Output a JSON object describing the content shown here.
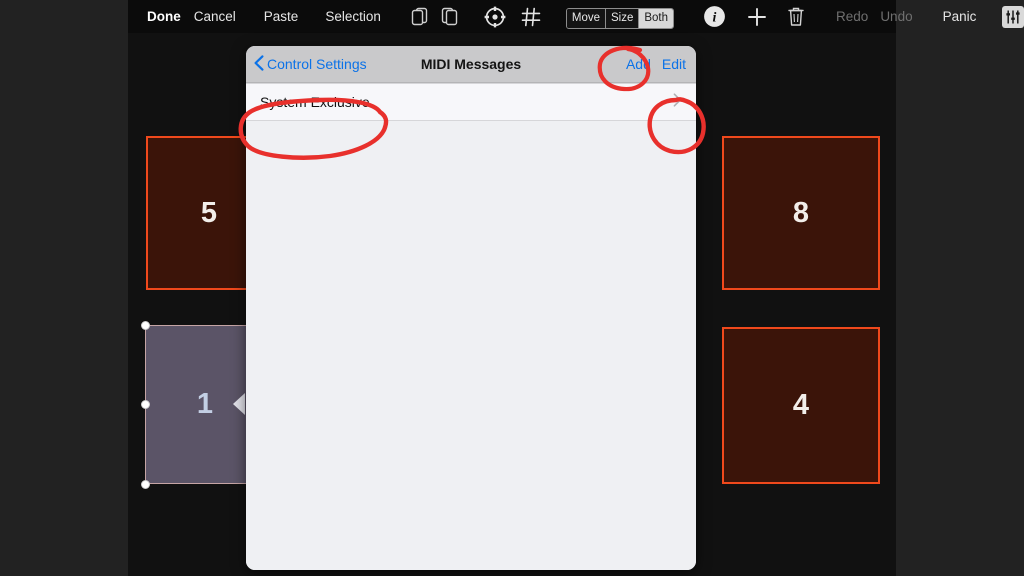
{
  "toolbar": {
    "items": [
      {
        "type": "text",
        "label": "Done",
        "style": "bold"
      },
      {
        "type": "text",
        "label": "Cancel",
        "style": "normal"
      },
      {
        "type": "text",
        "label": "Paste",
        "style": "normal"
      },
      {
        "type": "text",
        "label": "Selection",
        "style": "normal"
      },
      {
        "type": "icon",
        "label": "duplicate-front-icon"
      },
      {
        "type": "icon",
        "label": "duplicate-back-icon"
      },
      {
        "type": "icon",
        "label": "crosshair-target-icon"
      },
      {
        "type": "icon",
        "label": "grid-icon"
      },
      {
        "type": "segmented",
        "label": "move-size-both-control"
      },
      {
        "type": "icon",
        "label": "info-icon"
      },
      {
        "type": "icon",
        "label": "plus-icon"
      },
      {
        "type": "icon",
        "label": "trash-icon"
      },
      {
        "type": "text",
        "label": "Redo",
        "style": "dim"
      },
      {
        "type": "text",
        "label": "Undo",
        "style": "dim"
      },
      {
        "type": "text",
        "label": "Panic",
        "style": "normal"
      },
      {
        "type": "icon",
        "label": "mixer-sliders-icon"
      }
    ],
    "done_label": "Done",
    "cancel_label": "Cancel",
    "paste_label": "Paste",
    "selection_label": "Selection",
    "redo_label": "Redo",
    "undo_label": "Undo",
    "panic_label": "Panic",
    "segmented": {
      "options": [
        "Move",
        "Size",
        "Both"
      ],
      "selected": "Both"
    }
  },
  "canvas": {
    "pads": [
      {
        "label": "5",
        "state": "normal"
      },
      {
        "label": "8",
        "state": "normal"
      },
      {
        "label": "1",
        "state": "selected"
      },
      {
        "label": "4",
        "state": "normal"
      }
    ]
  },
  "modal": {
    "back_label": "Control Settings",
    "title": "MIDI Messages",
    "add_label": "Add",
    "edit_label": "Edit",
    "rows": [
      {
        "label": "System Exclusive",
        "disclosure": "chevron-right-icon"
      }
    ]
  },
  "colors": {
    "accent_blue": "#0b72e8",
    "pad_border": "#f0491c",
    "pad_fill": "#3b1409",
    "pad_selected_fill": "#5b5467",
    "annotation_red": "#e8302c",
    "modal_bg": "#eff0f3",
    "header_bg": "#c9c9cb"
  },
  "annotations": {
    "circle_add": "red-circle-around-add",
    "circle_row_label": "red-circle-around-system-exclusive",
    "circle_chevron": "red-circle-around-disclosure-chevron"
  }
}
